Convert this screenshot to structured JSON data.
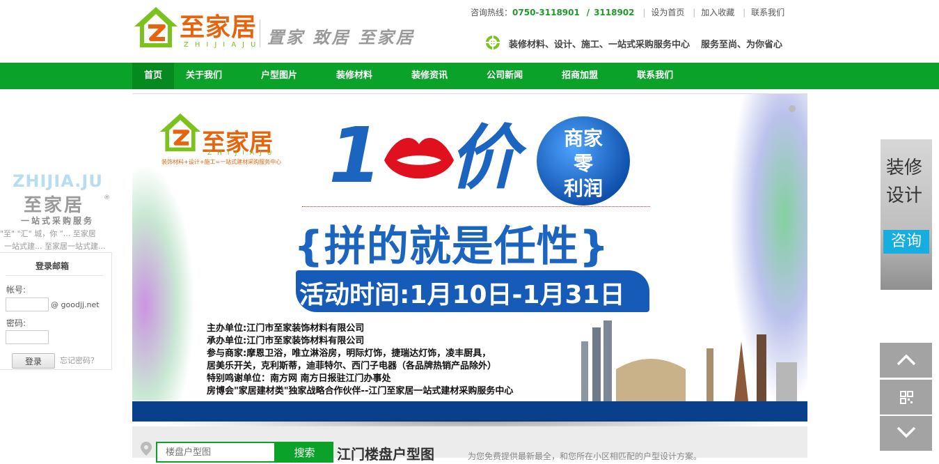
{
  "header": {
    "logo_name": "至家居",
    "logo_pinyin": "ZHIJIAJU",
    "slogan": "置家 致居 至家居",
    "hotline_label": "咨询热线：",
    "phone1": "0750-3118901",
    "phone_sep": "/",
    "phone2": "3118902",
    "links": [
      "设为首页",
      "加入收藏",
      "联系我们"
    ],
    "service1": "装修材料、设计、施工、一站式采购服务中心",
    "service2": "服务至尚、为你省心"
  },
  "nav": {
    "items": [
      "首页",
      "关于我们",
      "户型图片",
      "装修材料",
      "装修资讯",
      "公司新闻",
      "招商加盟",
      "联系我们"
    ],
    "active_index": 0
  },
  "banner": {
    "logo_name": "至家居",
    "logo_pinyin": "ZHIJIAJU",
    "logo_sub": "装饰材料+设计+施工=一站式建材采购服务中心",
    "big_number": "1",
    "price_char": "价",
    "circle_lines": [
      "商家",
      "零",
      "利润"
    ],
    "headline": "{拼的就是任性}",
    "time_text": "活动时间:1月10日-1月31日",
    "info_lines": [
      "主办单位:江门市至家装饰材料有限公司",
      "承办单位:江门市至家装饰材料有限公司",
      "参与商家:摩恩卫浴，唯立淋浴房，明际灯饰，捷瑞达灯饰，凌丰厨具，",
      "居美乐开关，克利斯蒂，迪菲特尔、西门子电器（各品牌热销产品除外）",
      "特别鸣谢单位：南方网  南方日报驻江门办事处",
      "房博会\"家居建材类\"独家战略合作伙伴--江门至家居一站式建材采购服务中心"
    ]
  },
  "search": {
    "placeholder": "楼盘户型图",
    "button": "搜索",
    "title": "江门楼盘户型图",
    "desc": "为您免费提供最新最全，和您所在小区相匹配的户型设计方案。"
  },
  "left_widget": {
    "brand_en": "ZHIJIA.JU",
    "brand_cn": "至家居",
    "reg": "®",
    "sub": "一站式采购服务",
    "text1": "\"至\"  \"汇\" 城，你 \"... 至家居",
    "text2": "一站式建... 至家居一站式建...",
    "login_title": "登录邮箱",
    "account_label": "帐号:",
    "domain": "@ goodjj.net",
    "password_label": "密码:",
    "login_button": "登录",
    "forgot": "忘记密码？"
  },
  "right_widget": {
    "line1": "装修",
    "line2": "设计",
    "consult": "咨询"
  },
  "colors": {
    "nav_green": "#0aa228",
    "nav_active": "#068a1f",
    "banner_blue": "#1b64c0",
    "logo_orange": "#e8640c"
  }
}
